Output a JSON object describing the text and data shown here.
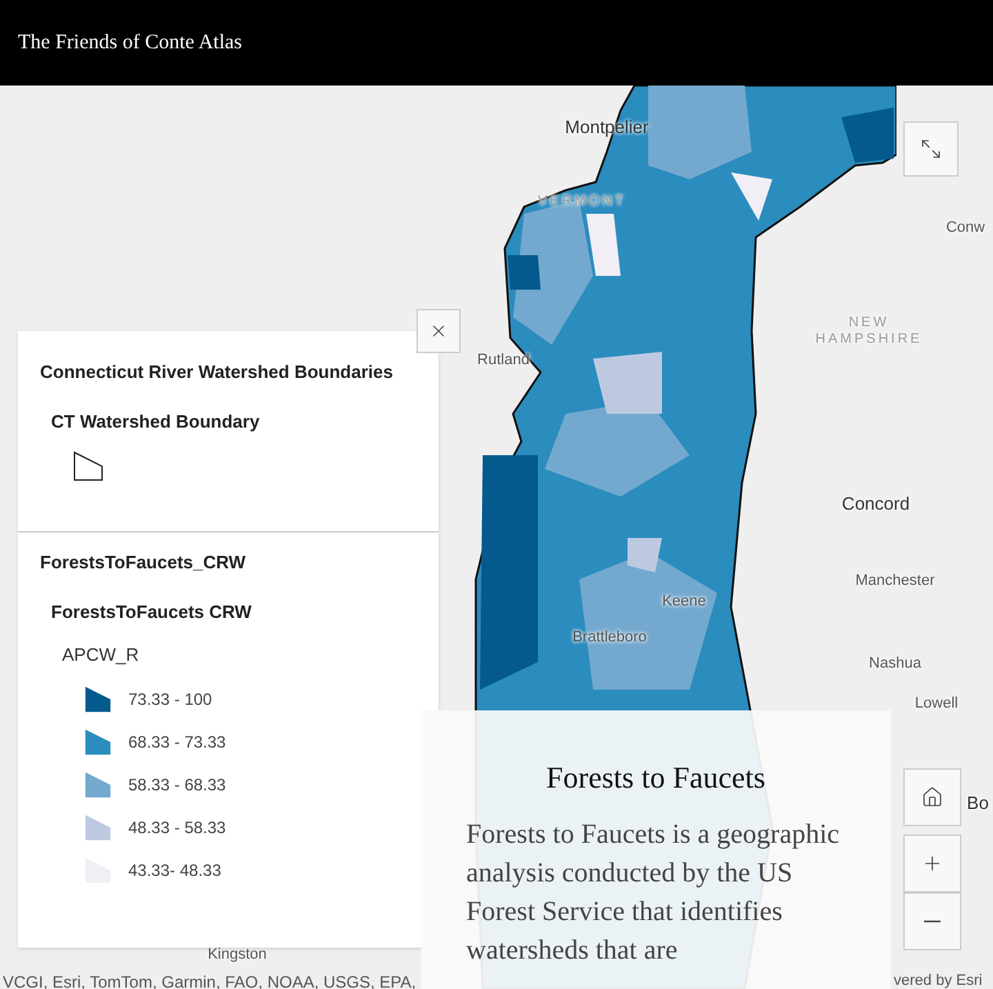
{
  "header": {
    "title": "The Friends of Conte Atlas"
  },
  "map": {
    "places": [
      {
        "label": "Montpelier",
        "kind": "city"
      },
      {
        "label": "VERMONT",
        "kind": "region"
      },
      {
        "label": "Conw",
        "kind": "town"
      },
      {
        "label": "NEW",
        "kind": "region"
      },
      {
        "label": "HAMPSHIRE",
        "kind": "region"
      },
      {
        "label": "Rutland",
        "kind": "town"
      },
      {
        "label": "Concord",
        "kind": "city"
      },
      {
        "label": "Manchester",
        "kind": "town"
      },
      {
        "label": "Keene",
        "kind": "town"
      },
      {
        "label": "Brattleboro",
        "kind": "town"
      },
      {
        "label": "Nashua",
        "kind": "town"
      },
      {
        "label": "Lowell",
        "kind": "town"
      },
      {
        "label": "Bo",
        "kind": "city"
      },
      {
        "label": "Kingston",
        "kind": "town"
      }
    ],
    "attribution": "VCGI, Esri, TomTom, Garmin, FAO, NOAA, USGS, EPA,",
    "powered": "vered by Esri"
  },
  "legend": {
    "layers": [
      {
        "title": "Connecticut River Watershed Boundaries",
        "sublayer": "CT Watershed Boundary",
        "kind": "outline"
      },
      {
        "title": "ForestsToFaucets_CRW",
        "sublayer": "ForestsToFaucets CRW",
        "kind": "classes",
        "field": "APCW_R",
        "classes": [
          {
            "label": "73.33 - 100",
            "color": "#045a8d"
          },
          {
            "label": "68.33 - 73.33",
            "color": "#2b8cbe"
          },
          {
            "label": "58.33 - 68.33",
            "color": "#74a9cf"
          },
          {
            "label": "48.33 - 58.33",
            "color": "#bdc9e1"
          },
          {
            "label": "43.33- 48.33",
            "color": "#f1eef6"
          }
        ]
      }
    ]
  },
  "story": {
    "title": "Forests to Faucets",
    "body": "Forests to Faucets is a geographic analysis conducted by the US Forest Service that identifies watersheds that are"
  }
}
